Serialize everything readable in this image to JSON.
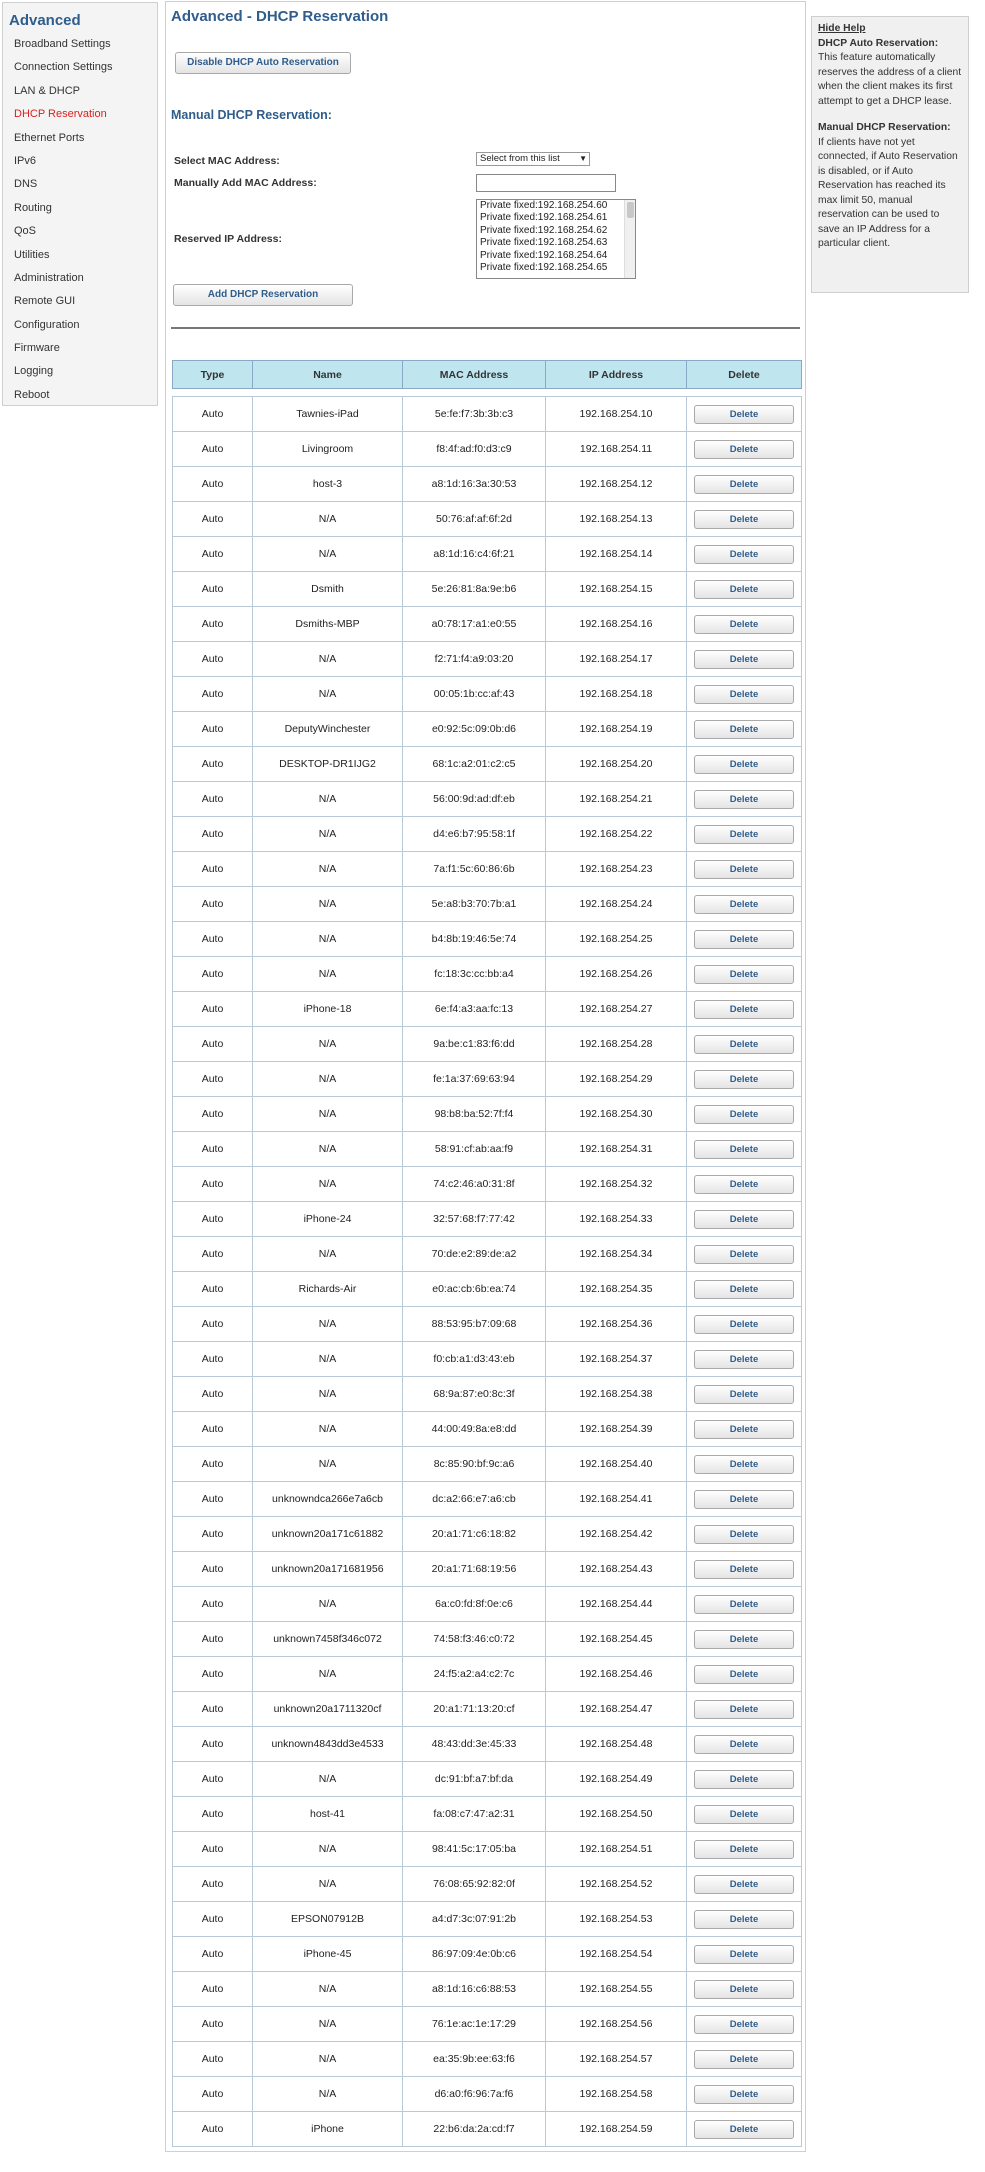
{
  "sidebar": {
    "title": "Advanced",
    "items": [
      {
        "label": "Broadband Settings",
        "active": false
      },
      {
        "label": "Connection Settings",
        "active": false
      },
      {
        "label": "LAN & DHCP",
        "active": false
      },
      {
        "label": "DHCP Reservation",
        "active": true
      },
      {
        "label": "Ethernet Ports",
        "active": false
      },
      {
        "label": "IPv6",
        "active": false
      },
      {
        "label": "DNS",
        "active": false
      },
      {
        "label": "Routing",
        "active": false
      },
      {
        "label": "QoS",
        "active": false
      },
      {
        "label": "Utilities",
        "active": false
      },
      {
        "label": "Administration",
        "active": false
      },
      {
        "label": "Remote GUI",
        "active": false
      },
      {
        "label": "Configuration",
        "active": false
      },
      {
        "label": "Firmware",
        "active": false
      },
      {
        "label": "Logging",
        "active": false
      },
      {
        "label": "Reboot",
        "active": false
      }
    ]
  },
  "main": {
    "title": "Advanced - DHCP Reservation",
    "disable_auto_button": "Disable DHCP Auto Reservation",
    "manual_section_title": "Manual DHCP Reservation:",
    "select_mac_label": "Select MAC Address:",
    "select_mac_value": "Select from this list",
    "manual_mac_label": "Manually Add MAC Address:",
    "manual_mac_value": "",
    "reserved_ip_label": "Reserved IP Address:",
    "reserved_ip_options": [
      "Private fixed:192.168.254.60",
      "Private fixed:192.168.254.61",
      "Private fixed:192.168.254.62",
      "Private fixed:192.168.254.63",
      "Private fixed:192.168.254.64",
      "Private fixed:192.168.254.65"
    ],
    "add_button": "Add DHCP Reservation"
  },
  "table": {
    "headers": [
      "Type",
      "Name",
      "MAC Address",
      "IP Address",
      "Delete"
    ],
    "delete_label": "Delete",
    "rows": [
      [
        "Auto",
        "Tawnies-iPad",
        "5e:fe:f7:3b:3b:c3",
        "192.168.254.10"
      ],
      [
        "Auto",
        "Livingroom",
        "f8:4f:ad:f0:d3:c9",
        "192.168.254.11"
      ],
      [
        "Auto",
        "host-3",
        "a8:1d:16:3a:30:53",
        "192.168.254.12"
      ],
      [
        "Auto",
        "N/A",
        "50:76:af:af:6f:2d",
        "192.168.254.13"
      ],
      [
        "Auto",
        "N/A",
        "a8:1d:16:c4:6f:21",
        "192.168.254.14"
      ],
      [
        "Auto",
        "Dsmith",
        "5e:26:81:8a:9e:b6",
        "192.168.254.15"
      ],
      [
        "Auto",
        "Dsmiths-MBP",
        "a0:78:17:a1:e0:55",
        "192.168.254.16"
      ],
      [
        "Auto",
        "N/A",
        "f2:71:f4:a9:03:20",
        "192.168.254.17"
      ],
      [
        "Auto",
        "N/A",
        "00:05:1b:cc:af:43",
        "192.168.254.18"
      ],
      [
        "Auto",
        "DeputyWinchester",
        "e0:92:5c:09:0b:d6",
        "192.168.254.19"
      ],
      [
        "Auto",
        "DESKTOP-DR1IJG2",
        "68:1c:a2:01:c2:c5",
        "192.168.254.20"
      ],
      [
        "Auto",
        "N/A",
        "56:00:9d:ad:df:eb",
        "192.168.254.21"
      ],
      [
        "Auto",
        "N/A",
        "d4:e6:b7:95:58:1f",
        "192.168.254.22"
      ],
      [
        "Auto",
        "N/A",
        "7a:f1:5c:60:86:6b",
        "192.168.254.23"
      ],
      [
        "Auto",
        "N/A",
        "5e:a8:b3:70:7b:a1",
        "192.168.254.24"
      ],
      [
        "Auto",
        "N/A",
        "b4:8b:19:46:5e:74",
        "192.168.254.25"
      ],
      [
        "Auto",
        "N/A",
        "fc:18:3c:cc:bb:a4",
        "192.168.254.26"
      ],
      [
        "Auto",
        "iPhone-18",
        "6e:f4:a3:aa:fc:13",
        "192.168.254.27"
      ],
      [
        "Auto",
        "N/A",
        "9a:be:c1:83:f6:dd",
        "192.168.254.28"
      ],
      [
        "Auto",
        "N/A",
        "fe:1a:37:69:63:94",
        "192.168.254.29"
      ],
      [
        "Auto",
        "N/A",
        "98:b8:ba:52:7f:f4",
        "192.168.254.30"
      ],
      [
        "Auto",
        "N/A",
        "58:91:cf:ab:aa:f9",
        "192.168.254.31"
      ],
      [
        "Auto",
        "N/A",
        "74:c2:46:a0:31:8f",
        "192.168.254.32"
      ],
      [
        "Auto",
        "iPhone-24",
        "32:57:68:f7:77:42",
        "192.168.254.33"
      ],
      [
        "Auto",
        "N/A",
        "70:de:e2:89:de:a2",
        "192.168.254.34"
      ],
      [
        "Auto",
        "Richards-Air",
        "e0:ac:cb:6b:ea:74",
        "192.168.254.35"
      ],
      [
        "Auto",
        "N/A",
        "88:53:95:b7:09:68",
        "192.168.254.36"
      ],
      [
        "Auto",
        "N/A",
        "f0:cb:a1:d3:43:eb",
        "192.168.254.37"
      ],
      [
        "Auto",
        "N/A",
        "68:9a:87:e0:8c:3f",
        "192.168.254.38"
      ],
      [
        "Auto",
        "N/A",
        "44:00:49:8a:e8:dd",
        "192.168.254.39"
      ],
      [
        "Auto",
        "N/A",
        "8c:85:90:bf:9c:a6",
        "192.168.254.40"
      ],
      [
        "Auto",
        "unknowndca266e7a6cb",
        "dc:a2:66:e7:a6:cb",
        "192.168.254.41"
      ],
      [
        "Auto",
        "unknown20a171c61882",
        "20:a1:71:c6:18:82",
        "192.168.254.42"
      ],
      [
        "Auto",
        "unknown20a171681956",
        "20:a1:71:68:19:56",
        "192.168.254.43"
      ],
      [
        "Auto",
        "N/A",
        "6a:c0:fd:8f:0e:c6",
        "192.168.254.44"
      ],
      [
        "Auto",
        "unknown7458f346c072",
        "74:58:f3:46:c0:72",
        "192.168.254.45"
      ],
      [
        "Auto",
        "N/A",
        "24:f5:a2:a4:c2:7c",
        "192.168.254.46"
      ],
      [
        "Auto",
        "unknown20a1711320cf",
        "20:a1:71:13:20:cf",
        "192.168.254.47"
      ],
      [
        "Auto",
        "unknown4843dd3e4533",
        "48:43:dd:3e:45:33",
        "192.168.254.48"
      ],
      [
        "Auto",
        "N/A",
        "dc:91:bf:a7:bf:da",
        "192.168.254.49"
      ],
      [
        "Auto",
        "host-41",
        "fa:08:c7:47:a2:31",
        "192.168.254.50"
      ],
      [
        "Auto",
        "N/A",
        "98:41:5c:17:05:ba",
        "192.168.254.51"
      ],
      [
        "Auto",
        "N/A",
        "76:08:65:92:82:0f",
        "192.168.254.52"
      ],
      [
        "Auto",
        "EPSON07912B",
        "a4:d7:3c:07:91:2b",
        "192.168.254.53"
      ],
      [
        "Auto",
        "iPhone-45",
        "86:97:09:4e:0b:c6",
        "192.168.254.54"
      ],
      [
        "Auto",
        "N/A",
        "a8:1d:16:c6:88:53",
        "192.168.254.55"
      ],
      [
        "Auto",
        "N/A",
        "76:1e:ac:1e:17:29",
        "192.168.254.56"
      ],
      [
        "Auto",
        "N/A",
        "ea:35:9b:ee:63:f6",
        "192.168.254.57"
      ],
      [
        "Auto",
        "N/A",
        "d6:a0:f6:96:7a:f6",
        "192.168.254.58"
      ],
      [
        "Auto",
        "iPhone",
        "22:b6:da:2a:cd:f7",
        "192.168.254.59"
      ]
    ]
  },
  "help": {
    "hide_label": "Hide Help",
    "auto_title": "DHCP Auto Reservation:",
    "auto_text": "This feature automatically reserves the address of a client when the client makes its first attempt to get a DHCP lease.",
    "manual_title": "Manual DHCP Reservation:",
    "manual_text": "If clients have not yet connected, if Auto Reservation is disabled, or if Auto Reservation has reached its max limit 50, manual reservation can be used to save an IP Address for a particular client."
  },
  "colors": {
    "accent": "#2f5d8c",
    "active_nav": "#d9211e",
    "table_header": "#bfe6ef"
  }
}
